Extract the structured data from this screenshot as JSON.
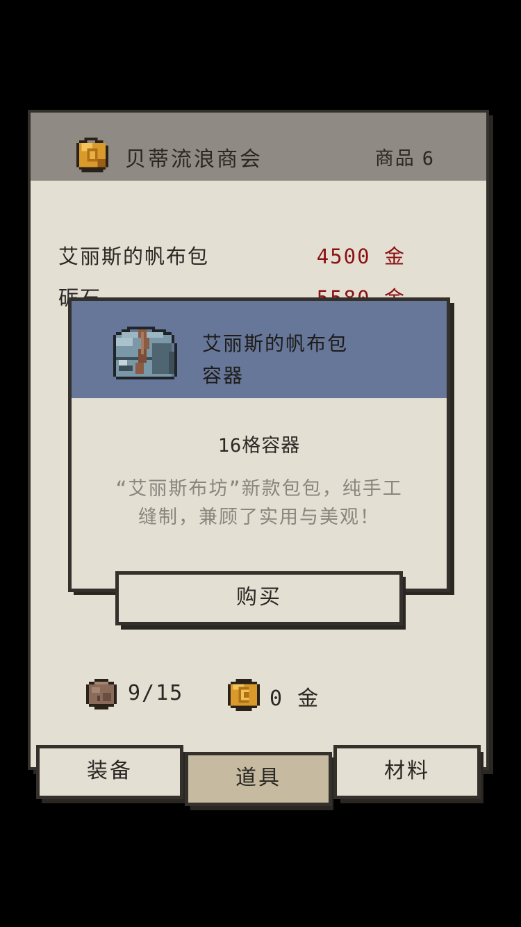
{
  "shop": {
    "title": "贝蒂流浪商会",
    "goods_label": "商品",
    "goods_count": "6"
  },
  "items": [
    {
      "name": "艾丽斯的帆布包",
      "price": "4500 金"
    },
    {
      "name": "砺石",
      "price": "5580 金"
    }
  ],
  "popup": {
    "item_name": "艾丽斯的帆布包",
    "item_type": "容器",
    "stat": "16格容器",
    "description": "“艾丽斯布坊”新款包包，纯手工缝制，兼顾了实用与美观！",
    "buy_label": "购买"
  },
  "status": {
    "bag": "9/15",
    "gold": "0 金"
  },
  "tabs": [
    {
      "label": "装备"
    },
    {
      "label": "道具",
      "active": true
    },
    {
      "label": "材料"
    }
  ],
  "colors": {
    "panel": "#e4dfd3",
    "header": "#8f8a83",
    "popup_header": "#66779a",
    "price": "#8b1212",
    "active_tab": "#c6bba0"
  },
  "icons": {
    "shop": "gold-coin-icon",
    "item": "backpack-icon",
    "bag": "pouch-icon",
    "gold": "coin-icon"
  }
}
